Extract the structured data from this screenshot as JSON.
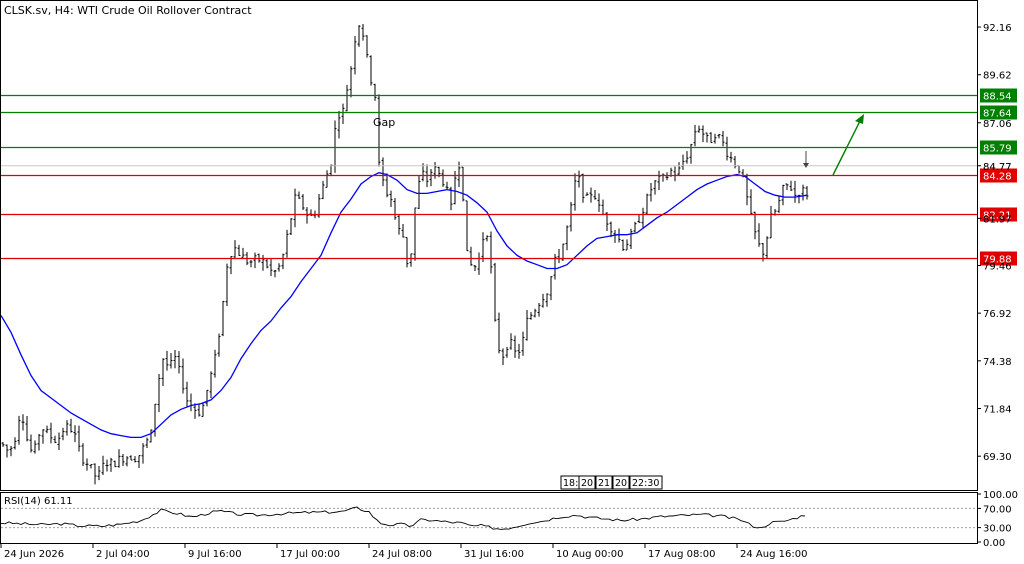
{
  "header": {
    "title": "CLSK.sv, H4:  WTI Crude Oil Rollover Contract"
  },
  "annotations": {
    "gap_label": "Gap"
  },
  "time_marker_labels": [
    "18:",
    "20",
    "21",
    "20",
    "22:30"
  ],
  "rsi_label": "RSI(14) 61.11",
  "colors": {
    "candle": "#000000",
    "ma_line": "#0000ff",
    "resistance": "#008000",
    "support": "#e00000",
    "arrow": "#008000",
    "grid": "#c0c0c0"
  },
  "chart_data": {
    "type": "candlestick",
    "symbol": "CLSK.sv",
    "timeframe": "H4",
    "instrument": "WTI Crude Oil Rollover Contract",
    "ylim": [
      67.5,
      93.6
    ],
    "y_ticks": [
      "92.16",
      "89.62",
      "87.06",
      "84.77",
      "81.97",
      "79.46",
      "76.92",
      "74.38",
      "71.84",
      "69.30"
    ],
    "x_ticks": [
      "24 Jun 2026",
      "2 Jul 04:00",
      "9 Jul 16:00",
      "17 Jul 00:00",
      "24 Jul 08:00",
      "31 Jul 16:00",
      "10 Aug 00:00",
      "17 Aug 08:00",
      "24 Aug 16:00"
    ],
    "current_price": "84.77",
    "resistance_levels": [
      "88.54",
      "87.64",
      "85.79"
    ],
    "support_levels": [
      "84.28",
      "82.21",
      "79.88"
    ],
    "price_path": [
      [
        0,
        70.0
      ],
      [
        8,
        69.5
      ],
      [
        14,
        70.3
      ],
      [
        20,
        71.9
      ],
      [
        26,
        70.2
      ],
      [
        32,
        69.3
      ],
      [
        40,
        70.9
      ],
      [
        48,
        70.4
      ],
      [
        56,
        70.1
      ],
      [
        64,
        70.9
      ],
      [
        72,
        70.7
      ],
      [
        80,
        69.3
      ],
      [
        88,
        68.8
      ],
      [
        96,
        68.1
      ],
      [
        104,
        69.0
      ],
      [
        112,
        68.9
      ],
      [
        120,
        69.2
      ],
      [
        128,
        69.3
      ],
      [
        136,
        69.2
      ],
      [
        144,
        69.9
      ],
      [
        150,
        70.5
      ],
      [
        156,
        73.0
      ],
      [
        162,
        74.5
      ],
      [
        168,
        74.0
      ],
      [
        174,
        74.5
      ],
      [
        180,
        73.5
      ],
      [
        186,
        72.3
      ],
      [
        194,
        71.8
      ],
      [
        200,
        71.6
      ],
      [
        208,
        73.2
      ],
      [
        214,
        74.5
      ],
      [
        220,
        76.5
      ],
      [
        226,
        79.5
      ],
      [
        232,
        80.5
      ],
      [
        240,
        80.0
      ],
      [
        248,
        79.6
      ],
      [
        256,
        79.8
      ],
      [
        264,
        79.6
      ],
      [
        272,
        79.0
      ],
      [
        280,
        79.5
      ],
      [
        288,
        81.5
      ],
      [
        294,
        83.0
      ],
      [
        300,
        82.8
      ],
      [
        306,
        82.2
      ],
      [
        312,
        82.0
      ],
      [
        318,
        83.0
      ],
      [
        324,
        84.0
      ],
      [
        330,
        85.0
      ],
      [
        336,
        87.5
      ],
      [
        342,
        87.7
      ],
      [
        348,
        89.5
      ],
      [
        352,
        90.5
      ],
      [
        356,
        92.6
      ],
      [
        362,
        91.8
      ],
      [
        368,
        89.8
      ],
      [
        374,
        88.5
      ],
      [
        378,
        84.8
      ],
      [
        384,
        83.5
      ],
      [
        390,
        83.0
      ],
      [
        396,
        81.5
      ],
      [
        402,
        81.0
      ],
      [
        408,
        79.0
      ],
      [
        414,
        82.5
      ],
      [
        420,
        84.5
      ],
      [
        426,
        84.0
      ],
      [
        432,
        84.7
      ],
      [
        438,
        84.3
      ],
      [
        444,
        83.8
      ],
      [
        450,
        82.5
      ],
      [
        456,
        85.0
      ],
      [
        460,
        84.8
      ],
      [
        466,
        80.0
      ],
      [
        472,
        79.2
      ],
      [
        478,
        79.8
      ],
      [
        484,
        81.5
      ],
      [
        488,
        81.0
      ],
      [
        492,
        77.5
      ],
      [
        496,
        75.2
      ],
      [
        502,
        74.7
      ],
      [
        508,
        75.5
      ],
      [
        514,
        74.8
      ],
      [
        520,
        75.0
      ],
      [
        526,
        76.5
      ],
      [
        532,
        77.0
      ],
      [
        538,
        77.5
      ],
      [
        544,
        78.0
      ],
      [
        548,
        78.2
      ],
      [
        552,
        79.5
      ],
      [
        558,
        80.0
      ],
      [
        564,
        80.9
      ],
      [
        570,
        82.5
      ],
      [
        576,
        84.5
      ],
      [
        580,
        83.5
      ],
      [
        586,
        83.0
      ],
      [
        592,
        83.5
      ],
      [
        598,
        82.5
      ],
      [
        604,
        82.0
      ],
      [
        610,
        81.5
      ],
      [
        616,
        81.0
      ],
      [
        622,
        80.5
      ],
      [
        628,
        80.8
      ],
      [
        634,
        81.5
      ],
      [
        640,
        82.2
      ],
      [
        646,
        83.0
      ],
      [
        652,
        83.8
      ],
      [
        658,
        84.0
      ],
      [
        664,
        84.1
      ],
      [
        670,
        84.5
      ],
      [
        676,
        84.3
      ],
      [
        682,
        85.0
      ],
      [
        688,
        85.5
      ],
      [
        696,
        87.0
      ],
      [
        702,
        86.5
      ],
      [
        708,
        86.0
      ],
      [
        714,
        86.5
      ],
      [
        720,
        86.2
      ],
      [
        726,
        85.5
      ],
      [
        732,
        85.0
      ],
      [
        740,
        84.5
      ],
      [
        746,
        83.0
      ],
      [
        752,
        81.5
      ],
      [
        758,
        80.5
      ],
      [
        762,
        80.2
      ],
      [
        766,
        81.0
      ],
      [
        770,
        82.0
      ],
      [
        776,
        82.5
      ],
      [
        782,
        83.5
      ],
      [
        788,
        83.8
      ],
      [
        794,
        83.2
      ],
      [
        800,
        83.5
      ],
      [
        806,
        83.3
      ]
    ],
    "ma_path": [
      [
        0,
        76.8
      ],
      [
        10,
        75.9
      ],
      [
        20,
        74.7
      ],
      [
        30,
        73.6
      ],
      [
        40,
        72.8
      ],
      [
        50,
        72.4
      ],
      [
        60,
        72.0
      ],
      [
        70,
        71.6
      ],
      [
        80,
        71.3
      ],
      [
        90,
        71.0
      ],
      [
        100,
        70.7
      ],
      [
        110,
        70.5
      ],
      [
        120,
        70.4
      ],
      [
        130,
        70.3
      ],
      [
        140,
        70.3
      ],
      [
        150,
        70.5
      ],
      [
        160,
        71.0
      ],
      [
        170,
        71.5
      ],
      [
        180,
        71.8
      ],
      [
        190,
        72.0
      ],
      [
        200,
        72.1
      ],
      [
        210,
        72.3
      ],
      [
        220,
        72.8
      ],
      [
        230,
        73.5
      ],
      [
        240,
        74.5
      ],
      [
        250,
        75.3
      ],
      [
        260,
        76.0
      ],
      [
        270,
        76.5
      ],
      [
        280,
        77.2
      ],
      [
        290,
        77.8
      ],
      [
        300,
        78.6
      ],
      [
        310,
        79.3
      ],
      [
        320,
        80.0
      ],
      [
        330,
        81.2
      ],
      [
        340,
        82.3
      ],
      [
        350,
        83.0
      ],
      [
        360,
        83.8
      ],
      [
        370,
        84.2
      ],
      [
        378,
        84.4
      ],
      [
        386,
        84.3
      ],
      [
        396,
        84.0
      ],
      [
        406,
        83.5
      ],
      [
        416,
        83.3
      ],
      [
        426,
        83.3
      ],
      [
        436,
        83.4
      ],
      [
        446,
        83.5
      ],
      [
        456,
        83.4
      ],
      [
        466,
        83.2
      ],
      [
        476,
        82.8
      ],
      [
        486,
        82.3
      ],
      [
        496,
        81.3
      ],
      [
        506,
        80.5
      ],
      [
        516,
        80.0
      ],
      [
        526,
        79.7
      ],
      [
        536,
        79.5
      ],
      [
        546,
        79.3
      ],
      [
        556,
        79.3
      ],
      [
        566,
        79.5
      ],
      [
        576,
        80.0
      ],
      [
        586,
        80.5
      ],
      [
        596,
        80.9
      ],
      [
        606,
        81.0
      ],
      [
        616,
        81.1
      ],
      [
        626,
        81.1
      ],
      [
        636,
        81.2
      ],
      [
        646,
        81.6
      ],
      [
        656,
        82.0
      ],
      [
        666,
        82.3
      ],
      [
        676,
        82.7
      ],
      [
        686,
        83.1
      ],
      [
        696,
        83.5
      ],
      [
        706,
        83.8
      ],
      [
        716,
        84.0
      ],
      [
        726,
        84.2
      ],
      [
        736,
        84.3
      ],
      [
        744,
        84.2
      ],
      [
        754,
        83.8
      ],
      [
        764,
        83.4
      ],
      [
        774,
        83.2
      ],
      [
        784,
        83.1
      ],
      [
        794,
        83.1
      ],
      [
        806,
        83.2
      ]
    ],
    "rsi": {
      "period": 14,
      "value": "61.11",
      "ylim": [
        0,
        100
      ],
      "y_ticks": [
        "100.00",
        "70.00",
        "30.00",
        "0.00"
      ],
      "levels": [
        70,
        30
      ],
      "path": [
        [
          0,
          40
        ],
        [
          20,
          38
        ],
        [
          40,
          36
        ],
        [
          60,
          38
        ],
        [
          80,
          34
        ],
        [
          100,
          33
        ],
        [
          120,
          37
        ],
        [
          140,
          45
        ],
        [
          150,
          55
        ],
        [
          160,
          66
        ],
        [
          170,
          62
        ],
        [
          180,
          58
        ],
        [
          190,
          52
        ],
        [
          200,
          56
        ],
        [
          210,
          62
        ],
        [
          220,
          64
        ],
        [
          240,
          57
        ],
        [
          260,
          56
        ],
        [
          280,
          59
        ],
        [
          300,
          61
        ],
        [
          320,
          62
        ],
        [
          340,
          63
        ],
        [
          356,
          71
        ],
        [
          368,
          63
        ],
        [
          378,
          40
        ],
        [
          390,
          35
        ],
        [
          400,
          37
        ],
        [
          410,
          33
        ],
        [
          420,
          46
        ],
        [
          430,
          46
        ],
        [
          440,
          43
        ],
        [
          450,
          41
        ],
        [
          460,
          40
        ],
        [
          470,
          33
        ],
        [
          480,
          34
        ],
        [
          490,
          30
        ],
        [
          500,
          27
        ],
        [
          510,
          30
        ],
        [
          520,
          35
        ],
        [
          530,
          41
        ],
        [
          540,
          43
        ],
        [
          560,
          53
        ],
        [
          576,
          56
        ],
        [
          586,
          52
        ],
        [
          600,
          49
        ],
        [
          620,
          45
        ],
        [
          640,
          48
        ],
        [
          660,
          53
        ],
        [
          680,
          55
        ],
        [
          700,
          57
        ],
        [
          720,
          54
        ],
        [
          740,
          46
        ],
        [
          750,
          35
        ],
        [
          760,
          29
        ],
        [
          770,
          41
        ],
        [
          780,
          42
        ],
        [
          790,
          47
        ],
        [
          806,
          58
        ]
      ]
    }
  }
}
